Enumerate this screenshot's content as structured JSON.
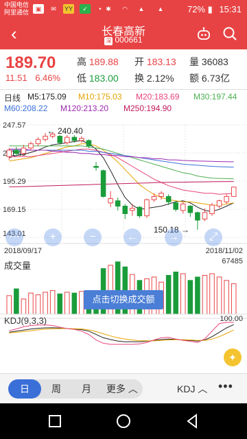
{
  "statusbar": {
    "carrier1": "中国电信",
    "carrier2": "阿里通信",
    "battery": "72%",
    "time": "15:31",
    "icons": [
      "notification-icon",
      "mail-icon",
      "yy-icon",
      "wechat-icon",
      "dot-icon",
      "bluetooth-icon",
      "wifi-icon",
      "signal-4g-icon",
      "signal-g-icon",
      "battery-icon"
    ]
  },
  "header": {
    "back": "‹",
    "title": "长春高新",
    "badge": "深",
    "code": "000661"
  },
  "quote": {
    "price": "189.70",
    "change": "11.51",
    "change_pct": "6.46%",
    "high_label": "高",
    "high": "189.88",
    "low_label": "低",
    "low": "183.00",
    "open_label": "开",
    "open": "183.13",
    "turnover_label": "换",
    "turnover": "2.12%",
    "volume_label": "量",
    "volume": "36083",
    "amount_label": "额",
    "amount": "6.73亿"
  },
  "ma": {
    "period": "日线",
    "m5": "M5:175.09",
    "m10": "M10:175.03",
    "m20": "M20:183.69",
    "m30": "M30:197.44",
    "m60": "M60:208.22",
    "m120": "M120:213.20",
    "m250": "M250:194.90"
  },
  "colors": {
    "up": "#e84344",
    "down": "#1a9c3b",
    "m5": "#222222",
    "m10": "#e6a200",
    "m20": "#e84377",
    "m30": "#4caf50",
    "m60": "#3a6fd8",
    "m120": "#9c27b0",
    "m250": "#c2185b"
  },
  "chart_data": [
    {
      "type": "candlestick",
      "y_ticks": [
        "247.57",
        "221.43",
        "195.29",
        "169.15",
        "143.01"
      ],
      "ylim": [
        143.01,
        247.57
      ],
      "annotations": {
        "high": "240.40",
        "low": "150.18"
      },
      "x_start": "2018/09/17",
      "x_end": "2018/11/02",
      "candles": [
        {
          "o": 218,
          "c": 224,
          "h": 226,
          "l": 215
        },
        {
          "o": 224,
          "c": 221,
          "h": 227,
          "l": 219
        },
        {
          "o": 221,
          "c": 226,
          "h": 229,
          "l": 219
        },
        {
          "o": 226,
          "c": 230,
          "h": 232,
          "l": 224
        },
        {
          "o": 230,
          "c": 234,
          "h": 236,
          "l": 228
        },
        {
          "o": 234,
          "c": 237,
          "h": 240,
          "l": 232
        },
        {
          "o": 237,
          "c": 239,
          "h": 240.4,
          "l": 235
        },
        {
          "o": 237,
          "c": 231,
          "h": 238,
          "l": 229
        },
        {
          "o": 231,
          "c": 236,
          "h": 238,
          "l": 229
        },
        {
          "o": 236,
          "c": 233,
          "h": 238,
          "l": 231
        },
        {
          "o": 233,
          "c": 235,
          "h": 237,
          "l": 231
        },
        {
          "o": 233,
          "c": 228,
          "h": 234,
          "l": 226
        },
        {
          "o": 209,
          "c": 208,
          "h": 213,
          "l": 205
        },
        {
          "o": 205,
          "c": 181,
          "h": 206,
          "l": 180
        },
        {
          "o": 175,
          "c": 179,
          "h": 186,
          "l": 171
        },
        {
          "o": 177,
          "c": 172,
          "h": 180,
          "l": 168
        },
        {
          "o": 172,
          "c": 165,
          "h": 174,
          "l": 160
        },
        {
          "o": 168,
          "c": 170,
          "h": 174,
          "l": 163
        },
        {
          "o": 171,
          "c": 163,
          "h": 172,
          "l": 161
        },
        {
          "o": 163,
          "c": 178,
          "h": 179,
          "l": 161
        },
        {
          "o": 178,
          "c": 181,
          "h": 184,
          "l": 176
        },
        {
          "o": 181,
          "c": 184,
          "h": 186,
          "l": 178
        },
        {
          "o": 181,
          "c": 176,
          "h": 183,
          "l": 173
        },
        {
          "o": 175,
          "c": 169,
          "h": 177,
          "l": 167
        },
        {
          "o": 168,
          "c": 174,
          "h": 176,
          "l": 165
        },
        {
          "o": 172,
          "c": 166,
          "h": 173,
          "l": 162
        },
        {
          "o": 166,
          "c": 159,
          "h": 167,
          "l": 150.18
        },
        {
          "o": 160,
          "c": 166,
          "h": 170,
          "l": 158
        },
        {
          "o": 165,
          "c": 173,
          "h": 175,
          "l": 163
        },
        {
          "o": 172,
          "c": 177,
          "h": 178,
          "l": 170
        },
        {
          "o": 176,
          "c": 181,
          "h": 183,
          "l": 174
        },
        {
          "o": 181,
          "c": 189.7,
          "h": 189.88,
          "l": 183
        }
      ],
      "ma_series": [
        {
          "name": "M5",
          "values": [
            217,
            219,
            220,
            222,
            224,
            227,
            229,
            230,
            231,
            232,
            233,
            230,
            225,
            217,
            205,
            192,
            180,
            173,
            169,
            170,
            171,
            172,
            174,
            176,
            177,
            175,
            171,
            168,
            167,
            169,
            172,
            175
          ]
        },
        {
          "name": "M10",
          "values": [
            214,
            215,
            216,
            217,
            219,
            221,
            223,
            225,
            227,
            228,
            230,
            230,
            228,
            224,
            219,
            213,
            206,
            199,
            192,
            187,
            183,
            180,
            178,
            177,
            176,
            176,
            175,
            174,
            173,
            173,
            174,
            175
          ]
        },
        {
          "name": "M20",
          "values": [
            218,
            218,
            218,
            218,
            219,
            220,
            221,
            222,
            223,
            224,
            225,
            225,
            224,
            222,
            220,
            217,
            213,
            209,
            205,
            201,
            197,
            194,
            191,
            189,
            187,
            186,
            185,
            184,
            184,
            183,
            183.5,
            183.7
          ]
        },
        {
          "name": "M30",
          "values": [
            228,
            228,
            228,
            228,
            228,
            228,
            228,
            228,
            228,
            228,
            228,
            227,
            226,
            225,
            223,
            221,
            219,
            217,
            215,
            213,
            211,
            209,
            207,
            205,
            203,
            202,
            200,
            199,
            198,
            197.8,
            197.6,
            197.4
          ]
        },
        {
          "name": "M60",
          "values": [
            224,
            224,
            224,
            224,
            224,
            224,
            224,
            224,
            224,
            224,
            224,
            223,
            223,
            222,
            221,
            220,
            219,
            218,
            217,
            216,
            215,
            214,
            213,
            212,
            211,
            210.5,
            210,
            209.5,
            209,
            208.7,
            208.4,
            208.2
          ]
        },
        {
          "name": "M120",
          "values": [
            225,
            225,
            225,
            224,
            224,
            224,
            223,
            223,
            222,
            222,
            221,
            221,
            220,
            220,
            219,
            219,
            218,
            218,
            217,
            217,
            216,
            216,
            215,
            215,
            214.5,
            214.2,
            214,
            213.8,
            213.6,
            213.4,
            213.3,
            213.2
          ]
        },
        {
          "name": "M250",
          "values": [
            190,
            190,
            190.2,
            190.4,
            190.6,
            190.8,
            191,
            191.2,
            191.4,
            191.6,
            191.8,
            192,
            192.2,
            192.4,
            192.6,
            192.8,
            193,
            193.2,
            193.4,
            193.6,
            193.8,
            194,
            194.1,
            194.2,
            194.3,
            194.4,
            194.5,
            194.6,
            194.7,
            194.8,
            194.85,
            194.9
          ]
        }
      ]
    },
    {
      "type": "bar",
      "title": "成交量",
      "max_label": "67485",
      "values": [
        22000,
        30000,
        18000,
        25000,
        23000,
        26000,
        28000,
        24000,
        26000,
        25000,
        27000,
        28000,
        25000,
        54000,
        58000,
        62000,
        56000,
        47000,
        40000,
        42000,
        44000,
        38000,
        46000,
        50000,
        48000,
        40000,
        44000,
        46000,
        48000,
        44000,
        40000,
        36083
      ]
    },
    {
      "type": "line",
      "title": "KDJ(9,3,3)",
      "max_label": "100.00",
      "series": [
        {
          "name": "K",
          "values": [
            55,
            60,
            65,
            70,
            73,
            75,
            76,
            74,
            72,
            70,
            67,
            60,
            45,
            30,
            22,
            15,
            12,
            12,
            12,
            14,
            18,
            22,
            24,
            22,
            20,
            18,
            15,
            20,
            35,
            55,
            75,
            90
          ]
        },
        {
          "name": "D",
          "values": [
            52,
            55,
            58,
            62,
            66,
            69,
            71,
            72,
            72,
            71,
            70,
            66,
            58,
            48,
            38,
            30,
            24,
            20,
            17,
            16,
            16,
            18,
            20,
            21,
            21,
            20,
            18,
            18,
            24,
            35,
            50,
            65
          ]
        },
        {
          "name": "J",
          "values": [
            62,
            70,
            80,
            86,
            88,
            88,
            86,
            78,
            72,
            68,
            60,
            45,
            20,
            5,
            0,
            0,
            0,
            0,
            2,
            8,
            20,
            30,
            32,
            24,
            18,
            14,
            8,
            25,
            60,
            95,
            100,
            100
          ]
        }
      ]
    }
  ],
  "controls": {
    "prev_icon": "prev-icon",
    "zoom_in_icon": "zoom-in-icon",
    "zoom_out_icon": "zoom-out-icon",
    "left_icon": "arrow-left-icon",
    "right_icon": "arrow-right-icon",
    "fullscreen_icon": "fullscreen-icon",
    "tooltip": "点击切换成交额"
  },
  "tabs": {
    "day": "日",
    "week": "周",
    "month": "月",
    "more": "更多 ︿",
    "indicator": "KDJ ︿",
    "overflow": "•••"
  }
}
